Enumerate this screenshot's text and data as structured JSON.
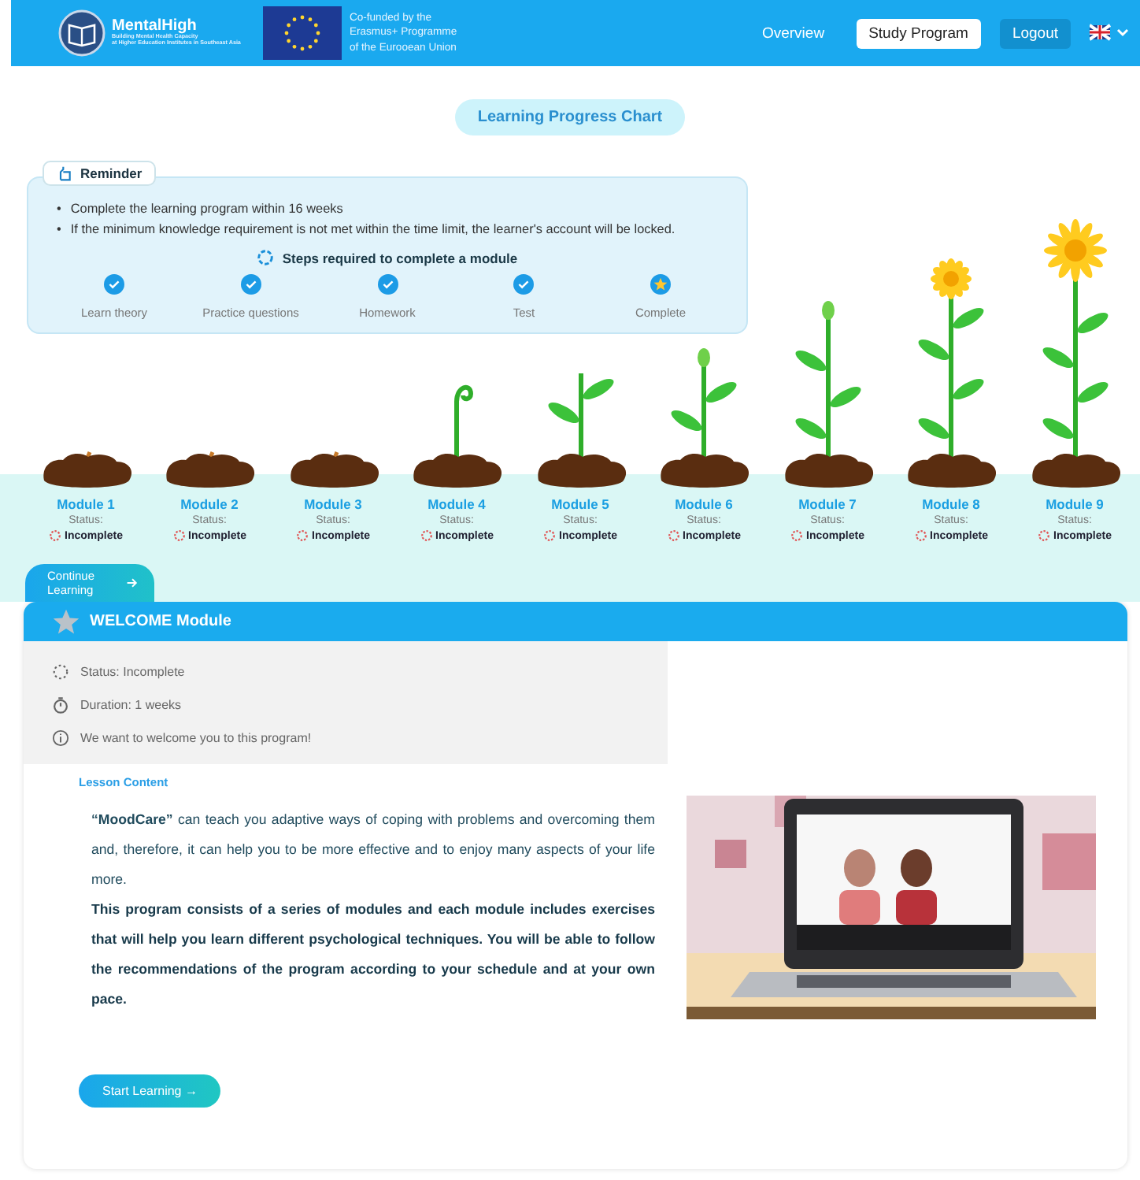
{
  "header": {
    "logo_title": "MentalHigh",
    "logo_tagline": [
      "Building Mental Health Capacity",
      "at Higher Education Institutes in Southeast Asia"
    ],
    "funding": [
      "Co-funded by the",
      "Erasmus+ Programme",
      "of the Eurooean Union"
    ],
    "nav": [
      {
        "label": "Overview",
        "kind": "link",
        "selected": false
      },
      {
        "label": "Study Program",
        "kind": "link",
        "selected": true
      },
      {
        "label": "Logout",
        "kind": "button",
        "selected": false
      }
    ]
  },
  "title": "Learning Progress Chart",
  "reminder": {
    "label": "Reminder",
    "bullet_marker": "•",
    "bullets": [
      "Complete the learning program within 16 weeks",
      "If the minimum knowledge requirement is not met within the time limit, the learner's account will be locked."
    ],
    "steps_title": "Steps required to complete a module",
    "steps": [
      {
        "label": "Learn theory",
        "kind": "check"
      },
      {
        "label": "Practice questions",
        "kind": "check"
      },
      {
        "label": "Homework",
        "kind": "check"
      },
      {
        "label": "Test",
        "kind": "check"
      },
      {
        "label": "Complete",
        "kind": "star"
      }
    ]
  },
  "modules": [
    {
      "name": "Module 1",
      "status_label": "Status:",
      "status": "Incomplete",
      "kind": "seed"
    },
    {
      "name": "Module 2",
      "status_label": "Status:",
      "status": "Incomplete",
      "kind": "seed"
    },
    {
      "name": "Module 3",
      "status_label": "Status:",
      "status": "Incomplete",
      "kind": "seed"
    },
    {
      "name": "Module 4",
      "status_label": "Status:",
      "status": "Incomplete",
      "kind": "sprout"
    },
    {
      "name": "Module 5",
      "status_label": "Status:",
      "status": "Incomplete",
      "kind": "seedling"
    },
    {
      "name": "Module 6",
      "status_label": "Status:",
      "status": "Incomplete",
      "kind": "plant"
    },
    {
      "name": "Module 7",
      "status_label": "Status:",
      "status": "Incomplete",
      "kind": "bud"
    },
    {
      "name": "Module 8",
      "status_label": "Status:",
      "status": "Incomplete",
      "kind": "flower"
    },
    {
      "name": "Module 9",
      "status_label": "Status:",
      "status": "Incomplete",
      "kind": "bloom"
    }
  ],
  "continue_button": "Continue Learning",
  "welcome": {
    "title": "WELCOME Module",
    "info": [
      {
        "kind": "status",
        "text": "Status: Incomplete"
      },
      {
        "kind": "duration",
        "text": "Duration: 1 weeks"
      },
      {
        "kind": "info",
        "text": "We want to welcome you to this program!"
      }
    ],
    "lesson_label": "Lesson Content",
    "paragraphs": [
      {
        "text": "**“MoodCare”** can teach you adaptive ways of coping with problems and overcoming them and, therefore, it can help you to be more effective and to enjoy many aspects of your life more.",
        "bold": false
      },
      {
        "text": "This program consists of a series of modules and each module includes exercises that will help you learn different psychological techniques. You will be able to follow the recommendations of the program according to your schedule and at your own pace.",
        "bold": true
      }
    ],
    "start_button": "Start Learning →"
  }
}
